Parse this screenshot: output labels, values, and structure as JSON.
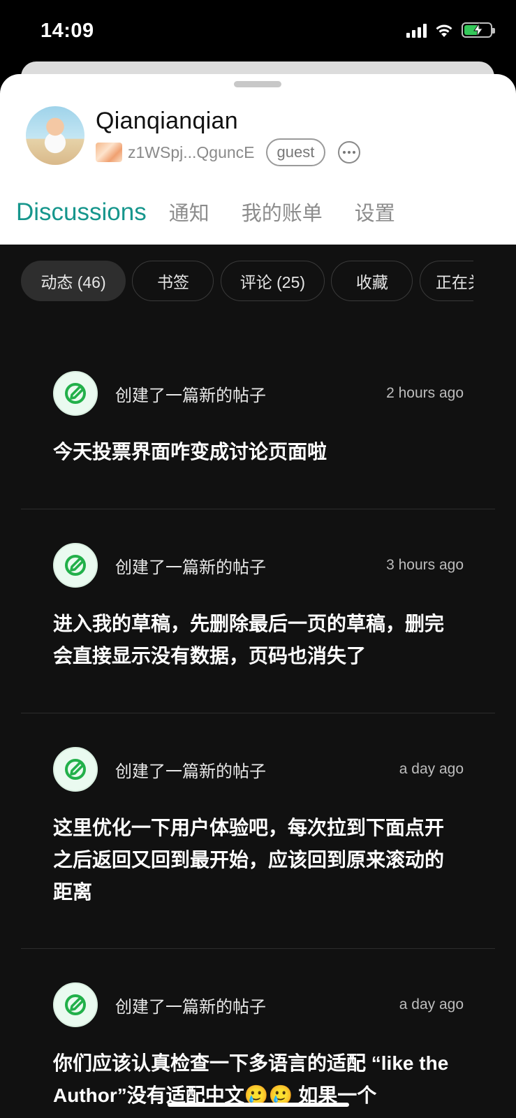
{
  "status_bar": {
    "time": "14:09",
    "battery_color": "#34c759"
  },
  "profile": {
    "username": "Qianqianqian",
    "address": "z1WSpj...QguncE",
    "role_badge": "guest"
  },
  "nav_tabs": [
    {
      "label": "Discussions",
      "active": true
    },
    {
      "label": "通知"
    },
    {
      "label": "我的账单"
    },
    {
      "label": "设置"
    }
  ],
  "filter_chips": [
    {
      "label": "动态 (46)",
      "active": true
    },
    {
      "label": "书签"
    },
    {
      "label": "评论 (25)"
    },
    {
      "label": "收藏"
    },
    {
      "label": "正在关"
    }
  ],
  "feed": [
    {
      "action": "创建了一篇新的帖子",
      "time": "2 hours ago",
      "body": "今天投票界面咋变成讨论页面啦"
    },
    {
      "action": "创建了一篇新的帖子",
      "time": "3 hours ago",
      "body": "进入我的草稿，先删除最后一页的草稿，删完会直接显示没有数据，页码也消失了"
    },
    {
      "action": "创建了一篇新的帖子",
      "time": "a day ago",
      "body": "这里优化一下用户体验吧，每次拉到下面点开之后返回又回到最开始，应该回到原来滚动的距离"
    },
    {
      "action": "创建了一篇新的帖子",
      "time": "a day ago",
      "body": "你们应该认真检查一下多语言的适配 “like the Author”没有适配中文🥲🥲 如果一个"
    }
  ],
  "accent_color": "#16968c",
  "icons": [
    "signal-icon",
    "wifi-icon",
    "battery-charging-icon",
    "more-icon",
    "pencil-icon"
  ]
}
